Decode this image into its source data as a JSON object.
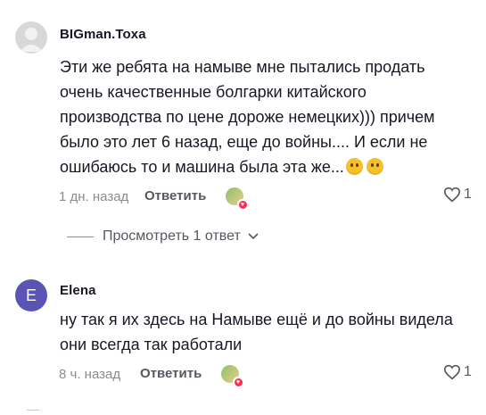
{
  "comments": [
    {
      "username": "BIGman.Toxa",
      "avatar_letter": "",
      "text_lines": [
        "Эти же ребята на намыве мне пытались продать",
        "очень качественные болгарки китайского",
        "производства по цене дороже немецких))) причем",
        "было это лет 6 назад, еще до войны.... И если не",
        "ошибаюсь то и машина была эта же..."
      ],
      "emojis": [
        "thinking-face",
        "smiling-face"
      ],
      "time": "1 дн. назад",
      "reply_label": "Ответить",
      "likes": "1"
    },
    {
      "username": "Elena",
      "avatar_letter": "E",
      "avatar_color": "#5a55b5",
      "text_lines": [
        "ну так я их здесь на Намыве ещё и до войны видела",
        "они всегда так работали"
      ],
      "time": "8 ч. назад",
      "reply_label": "Ответить",
      "likes": "1"
    }
  ],
  "view_replies": {
    "label": "Просмотреть 1 ответ"
  },
  "icons": {
    "like": "heart-outline-icon",
    "expand": "chevron-down-icon",
    "creator_liked": "creator-liked-badge-icon"
  }
}
